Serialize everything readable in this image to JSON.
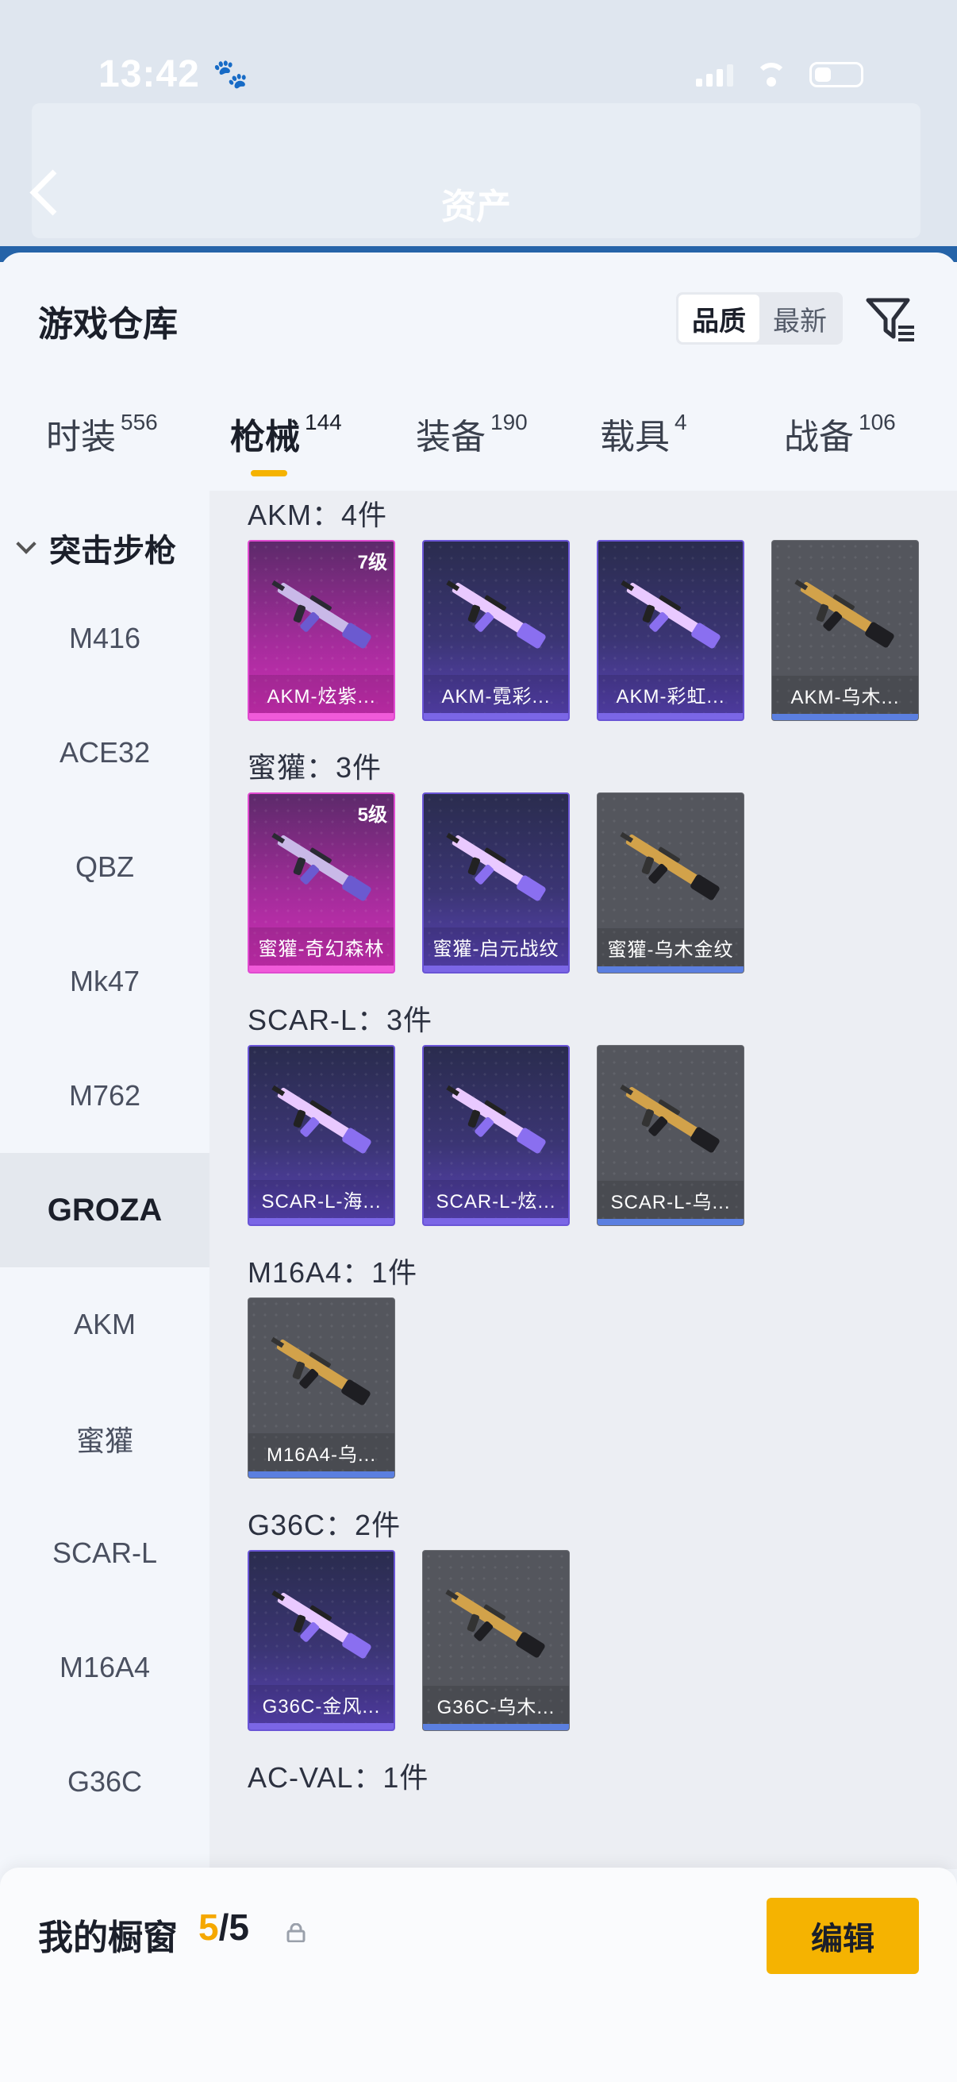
{
  "status_bar": {
    "time": "13:42"
  },
  "header": {
    "title": "资产"
  },
  "warehouse": {
    "title": "游戏仓库",
    "sort_quality": "品质",
    "sort_newest": "最新"
  },
  "tabs": [
    {
      "label": "时装",
      "count": "556"
    },
    {
      "label": "枪械",
      "count": "144"
    },
    {
      "label": "装备",
      "count": "190"
    },
    {
      "label": "载具",
      "count": "4"
    },
    {
      "label": "战备",
      "count": "106"
    }
  ],
  "categories": {
    "group": "突击步枪",
    "items": [
      "M416",
      "ACE32",
      "QBZ",
      "Mk47",
      "M762",
      "GROZA",
      "AKM",
      "蜜獾",
      "SCAR-L",
      "M16A4",
      "G36C"
    ],
    "active": "GROZA"
  },
  "groups": [
    {
      "title": "AKM：4件",
      "items": [
        {
          "name": "AKM-炫紫...",
          "level": "7级",
          "rarity": "pink"
        },
        {
          "name": "AKM-霓彩...",
          "level": "",
          "rarity": "purple"
        },
        {
          "name": "AKM-彩虹...",
          "level": "",
          "rarity": "purple"
        },
        {
          "name": "AKM-乌木...",
          "level": "",
          "rarity": "gray"
        }
      ]
    },
    {
      "title": "蜜獾：3件",
      "items": [
        {
          "name": "蜜獾-奇幻森林",
          "level": "5级",
          "rarity": "pink"
        },
        {
          "name": "蜜獾-启元战纹",
          "level": "",
          "rarity": "purple"
        },
        {
          "name": "蜜獾-乌木金纹",
          "level": "",
          "rarity": "gray"
        }
      ]
    },
    {
      "title": "SCAR-L：3件",
      "items": [
        {
          "name": "SCAR-L-海...",
          "level": "",
          "rarity": "purple"
        },
        {
          "name": "SCAR-L-炫...",
          "level": "",
          "rarity": "purple"
        },
        {
          "name": "SCAR-L-乌...",
          "level": "",
          "rarity": "gray"
        }
      ]
    },
    {
      "title": "M16A4：1件",
      "items": [
        {
          "name": "M16A4-乌...",
          "level": "",
          "rarity": "gray"
        }
      ]
    },
    {
      "title": "G36C：2件",
      "items": [
        {
          "name": "G36C-金风...",
          "level": "",
          "rarity": "purple"
        },
        {
          "name": "G36C-乌木...",
          "level": "",
          "rarity": "gray"
        }
      ]
    },
    {
      "title": "AC-VAL：1件",
      "items": []
    }
  ],
  "showcase": {
    "label": "我的橱窗",
    "current": "5",
    "total": "/5",
    "edit_label": "编辑"
  },
  "colors": {
    "accent": "#f5b301",
    "pink_rarity": "#d22fb8",
    "purple_rarity": "#5a43b8",
    "gray_rarity": "#54565d"
  },
  "icons": {
    "filter": "filter-icon",
    "share": "share-external-icon",
    "lock": "lock-icon",
    "back": "back-chevron-icon"
  }
}
